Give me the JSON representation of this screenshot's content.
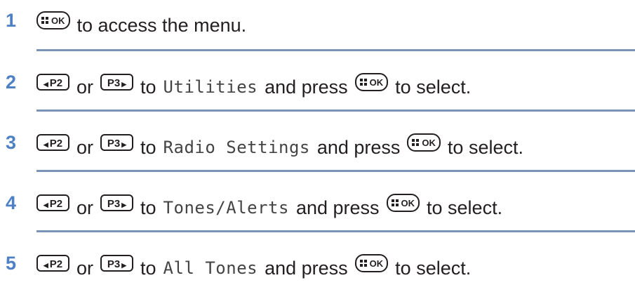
{
  "steps": [
    {
      "number": "1",
      "parts": [
        {
          "type": "key",
          "key": "ok"
        },
        {
          "type": "text",
          "text": "to access the menu."
        }
      ]
    },
    {
      "number": "2",
      "parts": [
        {
          "type": "key",
          "key": "p2"
        },
        {
          "type": "text",
          "text": "or"
        },
        {
          "type": "key",
          "key": "p3"
        },
        {
          "type": "text",
          "text": "to"
        },
        {
          "type": "mono",
          "text": "Utilities"
        },
        {
          "type": "text",
          "text": "and press"
        },
        {
          "type": "key",
          "key": "ok"
        },
        {
          "type": "text",
          "text": "to select."
        }
      ]
    },
    {
      "number": "3",
      "parts": [
        {
          "type": "key",
          "key": "p2"
        },
        {
          "type": "text",
          "text": "or"
        },
        {
          "type": "key",
          "key": "p3"
        },
        {
          "type": "text",
          "text": "to"
        },
        {
          "type": "mono",
          "text": "Radio Settings"
        },
        {
          "type": "text",
          "text": "and press"
        },
        {
          "type": "key",
          "key": "ok"
        },
        {
          "type": "text",
          "text": "to select."
        }
      ]
    },
    {
      "number": "4",
      "parts": [
        {
          "type": "key",
          "key": "p2"
        },
        {
          "type": "text",
          "text": "or"
        },
        {
          "type": "key",
          "key": "p3"
        },
        {
          "type": "text",
          "text": "to"
        },
        {
          "type": "mono",
          "text": "Tones/Alerts"
        },
        {
          "type": "text",
          "text": "and press"
        },
        {
          "type": "key",
          "key": "ok"
        },
        {
          "type": "text",
          "text": "to select."
        }
      ]
    },
    {
      "number": "5",
      "parts": [
        {
          "type": "key",
          "key": "p2"
        },
        {
          "type": "text",
          "text": "or"
        },
        {
          "type": "key",
          "key": "p3"
        },
        {
          "type": "text",
          "text": "to"
        },
        {
          "type": "mono",
          "text": "All Tones"
        },
        {
          "type": "text",
          "text": "and press"
        },
        {
          "type": "key",
          "key": "ok"
        },
        {
          "type": "text",
          "text": "to select."
        }
      ]
    }
  ],
  "keys": {
    "p2": {
      "label": "P2",
      "icon": "left-triangle-icon"
    },
    "p3": {
      "label": "P3",
      "icon": "right-triangle-icon"
    },
    "ok": {
      "label": "OK",
      "icon": "menu-grid-icon"
    }
  },
  "colors": {
    "step_number": "#4e81c3",
    "rule": "#7a94b6",
    "text": "#231f20"
  }
}
